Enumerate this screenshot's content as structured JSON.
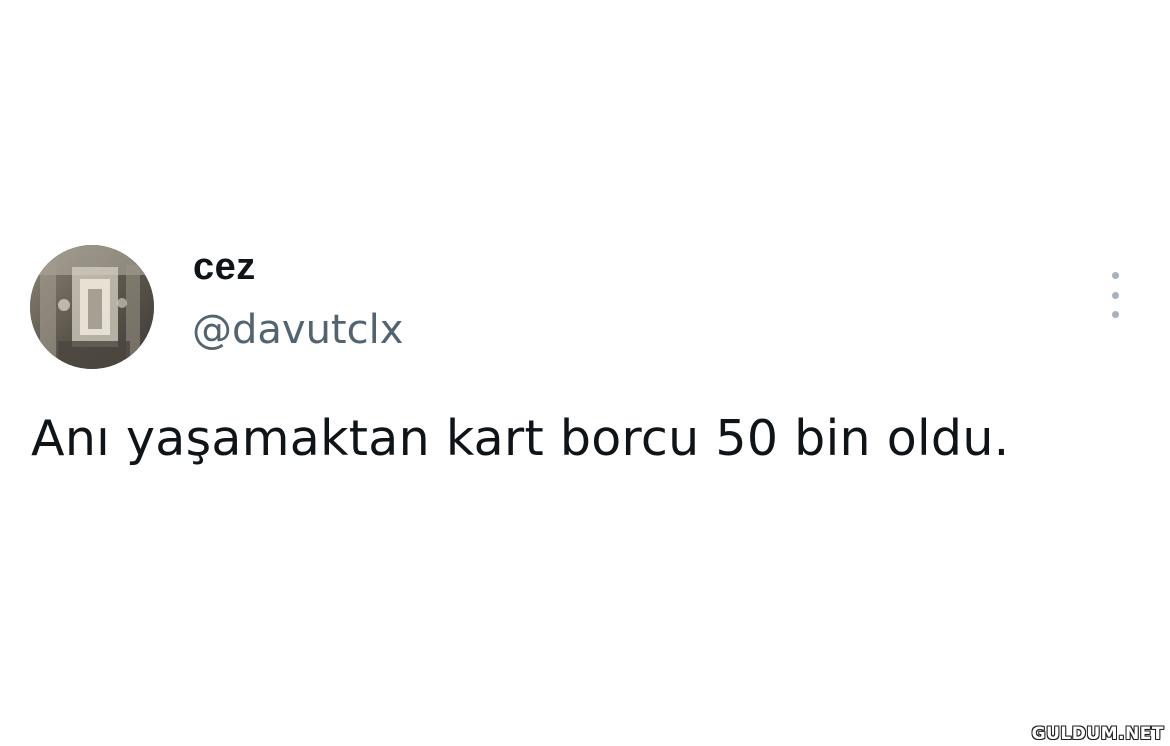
{
  "tweet": {
    "author": {
      "display_name": "cez",
      "handle": "@davutclx",
      "avatar_icon": "profile-photo"
    },
    "text": "Anı yaşamaktan kart borcu 50 bin oldu.",
    "more_icon": "more-vertical-icon"
  },
  "watermark": {
    "text": "GULDUM.NET"
  },
  "colors": {
    "background": "#ffffff",
    "text_primary": "#0f1419",
    "text_secondary": "#536471",
    "icon_muted": "#a9b2ba"
  }
}
